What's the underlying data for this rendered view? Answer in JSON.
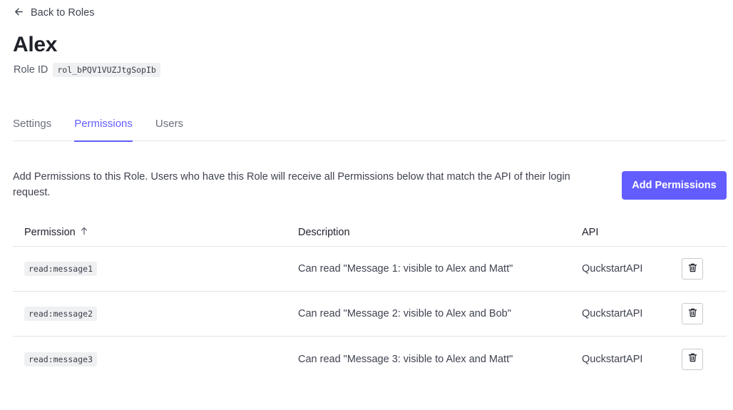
{
  "nav": {
    "back_label": "Back to Roles"
  },
  "role": {
    "name": "Alex",
    "id_label": "Role ID",
    "id_value": "rol_bPQV1VUZJtgSopIb"
  },
  "tabs": [
    {
      "label": "Settings",
      "active": false
    },
    {
      "label": "Permissions",
      "active": true
    },
    {
      "label": "Users",
      "active": false
    }
  ],
  "permissions_section": {
    "intro_text": "Add Permissions to this Role. Users who have this Role will receive all Permissions below that match the API of their login request.",
    "add_button_label": "Add Permissions"
  },
  "table": {
    "columns": {
      "permission": "Permission",
      "description": "Description",
      "api": "API"
    },
    "sort": {
      "column": "permission",
      "direction": "ascending",
      "icon": "arrow-up-icon"
    },
    "rows": [
      {
        "permission": "read:message1",
        "description": "Can read \"Message 1: visible to Alex and Matt\"",
        "api": "QuckstartAPI"
      },
      {
        "permission": "read:message2",
        "description": "Can read \"Message 2: visible to Alex and Bob\"",
        "api": "QuckstartAPI"
      },
      {
        "permission": "read:message3",
        "description": "Can read \"Message 3: visible to Alex and Matt\"",
        "api": "QuckstartAPI"
      }
    ]
  },
  "colors": {
    "accent": "#635dff",
    "text": "#1e212a",
    "muted": "#6b6f7b",
    "border": "#e3e4e8",
    "chip_bg": "#eff0f2"
  }
}
